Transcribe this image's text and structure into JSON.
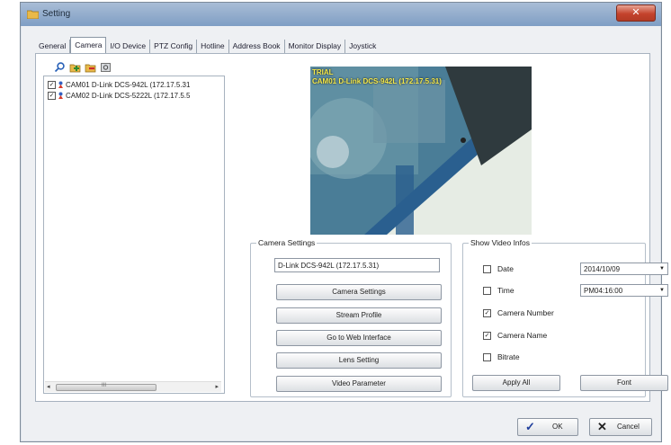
{
  "window": {
    "title": "Setting",
    "close_glyph": "✕"
  },
  "tabs": [
    {
      "label": "General",
      "active": false
    },
    {
      "label": "Camera",
      "active": true
    },
    {
      "label": "I/O Device",
      "active": false
    },
    {
      "label": "PTZ Config",
      "active": false
    },
    {
      "label": "Hotline",
      "active": false
    },
    {
      "label": "Address Book",
      "active": false
    },
    {
      "label": "Monitor Display",
      "active": false
    },
    {
      "label": "Joystick",
      "active": false
    }
  ],
  "toolbar": {
    "icons": [
      "search-icon",
      "add-camera-icon",
      "delete-camera-icon",
      "settings-icon"
    ]
  },
  "camera_list": {
    "items": [
      {
        "label": "CAM01 D-Link DCS-942L (172.17.5.31",
        "checked": true
      },
      {
        "label": "CAM02 D-Link DCS-5222L (172.17.5.5",
        "checked": true
      }
    ],
    "scroll_left": "◂",
    "scroll_right": "▸",
    "scroll_thumb": "III"
  },
  "video": {
    "overlay_line1": "TRIAL",
    "overlay_line2": "CAM01 D-Link DCS-942L (172.17.5.31)"
  },
  "camera_settings": {
    "title": "Camera Settings",
    "name_value": "D-Link DCS-942L (172.17.5.31)",
    "buttons": [
      "Camera Settings",
      "Stream Profile",
      "Go to Web Interface",
      "Lens Setting",
      "Video Parameter"
    ]
  },
  "video_infos": {
    "title": "Show Video Infos",
    "options": [
      {
        "label": "Date",
        "checked": false
      },
      {
        "label": "Time",
        "checked": false
      },
      {
        "label": "Camera Number",
        "checked": true
      },
      {
        "label": "Camera Name",
        "checked": true
      },
      {
        "label": "Bitrate",
        "checked": false
      }
    ],
    "date_value": "2014/10/09",
    "time_value": "PM04:16:00",
    "apply_all": "Apply All",
    "font": "Font"
  },
  "footer": {
    "ok_label": "OK",
    "ok_glyph": "✓",
    "cancel_label": "Cancel",
    "cancel_glyph": "✕"
  },
  "colors": {
    "titlebar": "#8fa9cb",
    "close": "#c4432d",
    "video_bg": "#3a6b8a",
    "overlay_text": "#f5e94a"
  }
}
